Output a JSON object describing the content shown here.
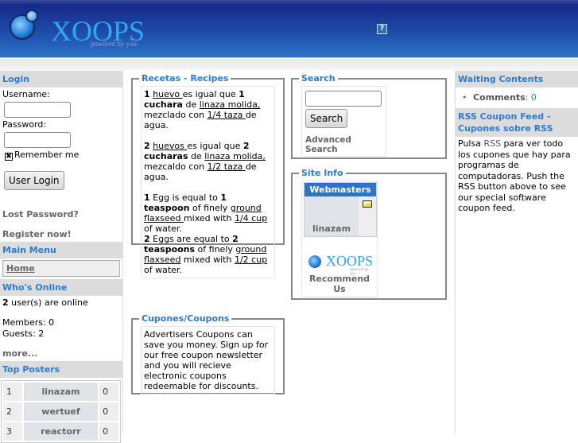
{
  "header": {
    "logo_text": "XOOPS",
    "logo_tagline": "powered by you",
    "help_icon": "?"
  },
  "left": {
    "login": {
      "title": "Login",
      "username_label": "Username:",
      "username_value": "",
      "password_label": "Password:",
      "password_value": "",
      "remember_label": "Remember me",
      "remember_checked": true,
      "submit": "User Login",
      "lost_password": "Lost Password?",
      "register": "Register now!"
    },
    "main_menu": {
      "title": "Main Menu",
      "items": [
        "Home"
      ]
    },
    "whos_online": {
      "title": "Who's Online",
      "count": "2",
      "online_text": " user(s) are online",
      "members": "Members: 0",
      "guests": "Guests: 2",
      "more": "more..."
    },
    "top_posters": {
      "title": "Top Posters",
      "rows": [
        [
          "1",
          "linazam",
          "0"
        ],
        [
          "2",
          "wertuef",
          "0"
        ],
        [
          "3",
          "reactorr",
          "0"
        ]
      ]
    }
  },
  "center": {
    "recipes": {
      "title": "Recetas - Recipes",
      "paragraphs": [
        [
          {
            "t": "1",
            "b": 1
          },
          {
            "t": " "
          },
          {
            "t": "huevo ",
            "u": 1
          },
          {
            "t": "es igual que "
          },
          {
            "t": "1 cuchara",
            "b": 1
          },
          {
            "t": " de "
          },
          {
            "t": "linaza molida,",
            "u": 1
          },
          {
            "t": " mezclado con "
          },
          {
            "t": "1/4 taza ",
            "u": 1
          },
          {
            "t": "de agua."
          }
        ],
        [
          {
            "t": "2",
            "b": 1
          },
          {
            "t": " "
          },
          {
            "t": "huevos ",
            "u": 1
          },
          {
            "t": "es igual que "
          },
          {
            "t": "2 cucharas",
            "b": 1
          },
          {
            "t": " de "
          },
          {
            "t": "linaza molida,",
            "u": 1
          },
          {
            "t": " mezcaldo con "
          },
          {
            "t": "1/2 taza ",
            "u": 1
          },
          {
            "t": "de agua."
          }
        ],
        [
          {
            "t": "1",
            "b": 1
          },
          {
            "t": " Egg is equal to "
          },
          {
            "t": "1 teaspoon",
            "b": 1
          },
          {
            "t": " of finely "
          },
          {
            "t": "ground flaxseed ",
            "u": 1
          },
          {
            "t": "mixed with "
          },
          {
            "t": "1/4 cup ",
            "u": 1
          },
          {
            "t": "of water."
          },
          {
            "br": 1
          },
          {
            "t": "2",
            "b": 1
          },
          {
            "t": " Eggs are equal to "
          },
          {
            "t": "2 teaspoons",
            "b": 1
          },
          {
            "t": " of finely "
          },
          {
            "t": "ground flaxseed",
            "u": 1
          },
          {
            "t": " mixed with "
          },
          {
            "t": "1/2 cup ",
            "u": 1
          },
          {
            "t": "of water."
          }
        ]
      ]
    },
    "coupons": {
      "title": "Cupones/Coupons",
      "text": "Advertisers Coupons can save you money. Sign up for our free coupon newsletter and you will recieve electronic coupons redeemable for discounts."
    },
    "search": {
      "title": "Search",
      "value": "",
      "button": "Search",
      "advanced": "Advanced Search"
    },
    "site_info": {
      "title": "Site Info",
      "webmasters_title": "Webmasters",
      "webmaster_name": "linazam",
      "mail_icon": "envelope-icon",
      "recommend": "Recommend Us",
      "logo_text": "XOOPS",
      "logo_tagline": "powered by you"
    }
  },
  "right": {
    "waiting": {
      "title": "Waiting Contents",
      "items": [
        {
          "label": "Comments",
          "value": "0"
        }
      ]
    },
    "rss": {
      "title": "RSS Coupon Feed - Cupones sobre RSS",
      "text_pre": "Pulsa ",
      "link": "RSS",
      "text_post": " para ver todo los cupones que hay para programas de computadoras. Push the RSS button above to see our special software coupon feed."
    }
  },
  "colors": {
    "accent": "#2b7bd0",
    "header": "#1f4aa8",
    "block_title_bg": "#dcdcdc"
  }
}
